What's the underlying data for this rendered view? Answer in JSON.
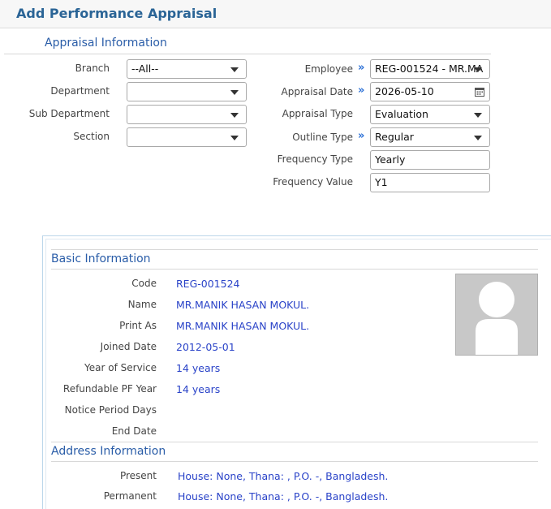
{
  "page": {
    "title": "Add Performance Appraisal"
  },
  "appraisal_info": {
    "title": "Appraisal Information",
    "branch": {
      "label": "Branch",
      "value": "--All--"
    },
    "department": {
      "label": "Department",
      "value": ""
    },
    "sub_department": {
      "label": "Sub Department",
      "value": ""
    },
    "section": {
      "label": "Section",
      "value": ""
    },
    "employee": {
      "label": "Employee",
      "value": "REG-001524 - MR.MA"
    },
    "appraisal_date": {
      "label": "Appraisal Date",
      "value": "2026-05-10"
    },
    "appraisal_type": {
      "label": "Appraisal Type",
      "value": "Evaluation"
    },
    "outline_type": {
      "label": "Outline Type",
      "value": "Regular"
    },
    "frequency_type": {
      "label": "Frequency Type",
      "value": "Yearly"
    },
    "frequency_value": {
      "label": "Frequency Value",
      "value": "Y1"
    }
  },
  "basic_info": {
    "title": "Basic Information",
    "rows": [
      {
        "label": "Code",
        "value": "REG-001524"
      },
      {
        "label": "Name",
        "value": "MR.MANIK HASAN MOKUL."
      },
      {
        "label": "Print As",
        "value": "MR.MANIK HASAN MOKUL."
      },
      {
        "label": "Joined Date",
        "value": "2012-05-01"
      },
      {
        "label": "Year of Service",
        "value": "14 years"
      },
      {
        "label": "Refundable PF Year",
        "value": "14 years"
      },
      {
        "label": "Notice Period Days",
        "value": ""
      },
      {
        "label": "End Date",
        "value": ""
      }
    ]
  },
  "address_info": {
    "title": "Address Information",
    "present": {
      "label": "Present",
      "value": "House: None, Thana: , P.O. -, Bangladesh."
    },
    "permanent": {
      "label": "Permanent",
      "value": "House: None, Thana: , P.O. -, Bangladesh."
    }
  },
  "colors": {
    "accent": "#2a6496",
    "link_value": "#2a43c8",
    "arrow": "#2a6fd6"
  }
}
